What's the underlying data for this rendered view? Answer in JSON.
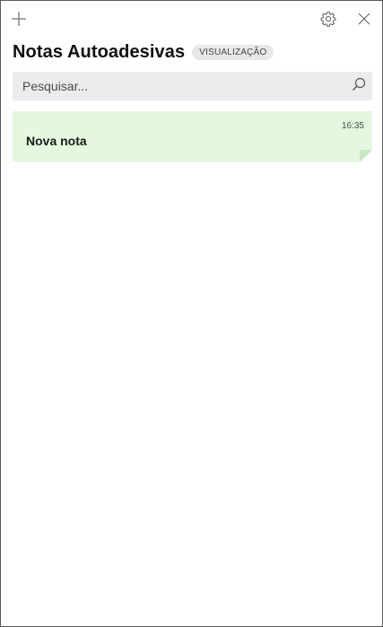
{
  "titlebar": {
    "add_icon": "plus-icon",
    "settings_icon": "gear-icon",
    "close_icon": "close-icon"
  },
  "header": {
    "title": "Notas Autoadesivas",
    "badge": "VISUALIZAÇÃO"
  },
  "search": {
    "placeholder": "Pesquisar...",
    "value": "",
    "icon": "search-icon"
  },
  "notes": [
    {
      "title": "Nova nota",
      "time": "16:35",
      "color": "#e3f8de"
    }
  ],
  "colors": {
    "note_green": "#e3f8de",
    "note_fold": "#c9e6c2",
    "search_bg": "#ececec",
    "badge_bg": "#e8e8e8"
  }
}
